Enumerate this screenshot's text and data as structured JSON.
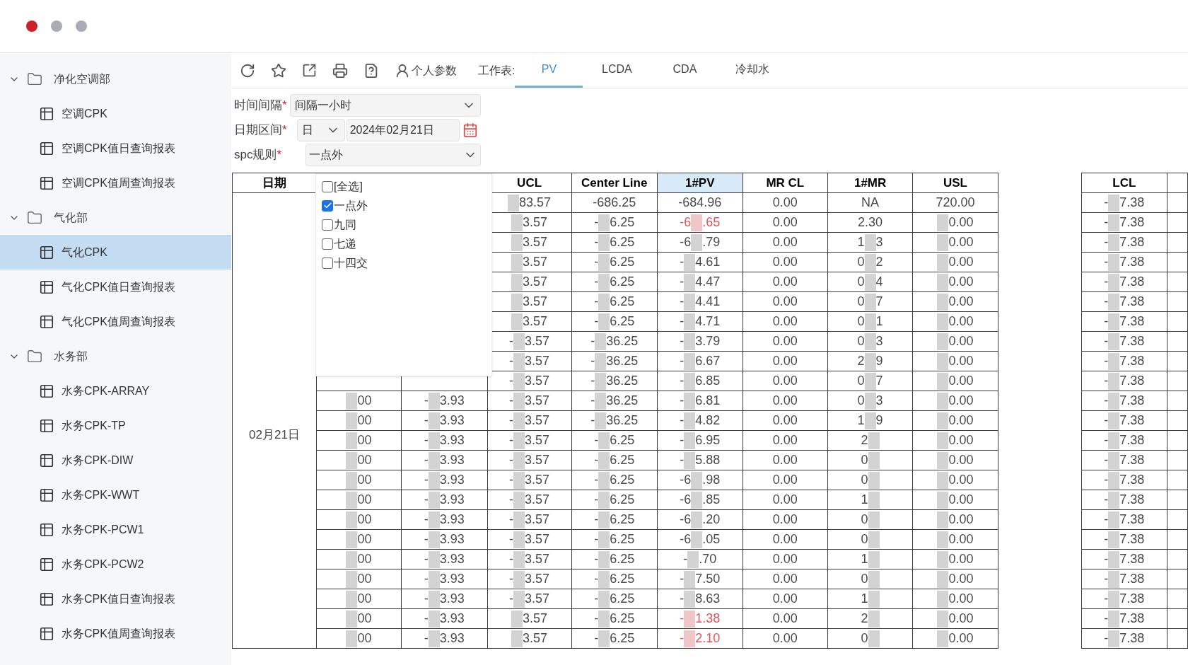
{
  "window_controls": [
    {
      "color": "#cf1f2b"
    },
    {
      "color": "#a9abb8"
    },
    {
      "color": "#a9abb8"
    }
  ],
  "sidebar": {
    "tree": [
      {
        "label": "净化空调部",
        "expanded": true,
        "children": [
          {
            "label": "空调CPK",
            "selected": false
          },
          {
            "label": "空调CPK值日查询报表",
            "selected": false
          },
          {
            "label": "空调CPK值周查询报表",
            "selected": false
          }
        ]
      },
      {
        "label": "气化部",
        "expanded": true,
        "children": [
          {
            "label": "气化CPK",
            "selected": true
          },
          {
            "label": "气化CPK值日查询报表",
            "selected": false
          },
          {
            "label": "气化CPK值周查询报表",
            "selected": false
          }
        ]
      },
      {
        "label": "水务部",
        "expanded": true,
        "children": [
          {
            "label": "水务CPK-ARRAY",
            "selected": false
          },
          {
            "label": "水务CPK-TP",
            "selected": false
          },
          {
            "label": "水务CPK-DIW",
            "selected": false
          },
          {
            "label": "水务CPK-WWT",
            "selected": false
          },
          {
            "label": "水务CPK-PCW1",
            "selected": false
          },
          {
            "label": "水务CPK-PCW2",
            "selected": false
          },
          {
            "label": "水务CPK值日查询报表",
            "selected": false
          },
          {
            "label": "水务CPK值周查询报表",
            "selected": false
          }
        ]
      }
    ]
  },
  "toolbar": {
    "personal_params": "个人参数",
    "sheet_label": "工作表:",
    "sheet_tabs": [
      {
        "label": "PV",
        "selected": true
      },
      {
        "label": "LCDA",
        "selected": false
      },
      {
        "label": "CDA",
        "selected": false
      },
      {
        "label": "冷却水",
        "selected": false
      }
    ]
  },
  "filters": {
    "interval": {
      "label": "时间间隔",
      "required_mark": "*",
      "value": "间隔一小时"
    },
    "date_range": {
      "label": "日期区间",
      "required_mark": "*",
      "unit": "日",
      "date": "2024年02月21日"
    },
    "spc_rule": {
      "label": "spc规则",
      "required_mark": "*",
      "value": "一点外",
      "open": true,
      "options": [
        {
          "label": "[全选]",
          "checked": false
        },
        {
          "label": "一点外",
          "checked": true
        },
        {
          "label": "九同",
          "checked": false
        },
        {
          "label": "七递",
          "checked": false
        },
        {
          "label": "十四交",
          "checked": false
        }
      ]
    }
  },
  "table": {
    "columns": [
      {
        "label": "日期",
        "highlighted": false
      },
      {
        "label": "UCL",
        "highlighted": false
      },
      {
        "label": "Center Line",
        "highlighted": false
      },
      {
        "label": "1#PV",
        "highlighted": true
      },
      {
        "label": "MR CL",
        "highlighted": false
      },
      {
        "label": "1#MR",
        "highlighted": false
      },
      {
        "label": "USL",
        "highlighted": false
      },
      {
        "label": "LCL",
        "highlighted": false
      }
    ],
    "date": "02月21日",
    "rows": [
      {
        "ucl": {
          "tail": "83.57"
        },
        "center": {
          "text": "-686.25"
        },
        "pv": {
          "text": "-684.96"
        },
        "pv_alert": false,
        "mr_cl": {
          "text": "0.00"
        },
        "mr": {
          "text": "NA"
        },
        "usl": {
          "text": "720.00"
        },
        "lcl": {
          "lead": "-",
          "tail": "7.38"
        }
      },
      {
        "ucl": {
          "tail": "3.57"
        },
        "center": {
          "lead": "-",
          "tail": "6.25"
        },
        "pv": {
          "lead": "-6",
          "tail": ".65"
        },
        "pv_alert": true,
        "mr_cl": {
          "text": "0.00"
        },
        "mr": {
          "text": "2.30"
        },
        "usl": {
          "tail": "0.00"
        },
        "lcl": {
          "lead": "-",
          "tail": "7.38"
        }
      },
      {
        "ucl": {
          "tail": "3.57"
        },
        "center": {
          "lead": "-",
          "tail": "6.25"
        },
        "pv": {
          "lead": "-6",
          "tail": ".79"
        },
        "pv_alert": false,
        "mr_cl": {
          "text": "0.00"
        },
        "mr": {
          "lead": "1",
          "tail": "3"
        },
        "usl": {
          "tail": "0.00"
        },
        "lcl": {
          "lead": "-",
          "tail": "7.38"
        }
      },
      {
        "ucl": {
          "tail": "3.57"
        },
        "center": {
          "lead": "-",
          "tail": "6.25"
        },
        "pv": {
          "lead": "-",
          "tail": "4.61"
        },
        "pv_alert": false,
        "mr_cl": {
          "text": "0.00"
        },
        "mr": {
          "lead": "0",
          "tail": "2"
        },
        "usl": {
          "tail": "0.00"
        },
        "lcl": {
          "lead": "-",
          "tail": "7.38"
        }
      },
      {
        "ucl": {
          "tail": "3.57"
        },
        "center": {
          "lead": "-",
          "tail": "6.25"
        },
        "pv": {
          "lead": "-",
          "tail": "4.47"
        },
        "pv_alert": false,
        "mr_cl": {
          "text": "0.00"
        },
        "mr": {
          "lead": "0",
          "tail": "4"
        },
        "usl": {
          "tail": "0.00"
        },
        "lcl": {
          "lead": "-",
          "tail": "7.38"
        }
      },
      {
        "ucl": {
          "tail": "3.57"
        },
        "center": {
          "lead": "-",
          "tail": "6.25"
        },
        "pv": {
          "lead": "-",
          "tail": "4.41"
        },
        "pv_alert": false,
        "mr_cl": {
          "text": "0.00"
        },
        "mr": {
          "lead": "0",
          "tail": "7"
        },
        "usl": {
          "tail": "0.00"
        },
        "lcl": {
          "lead": "-",
          "tail": "7.38"
        }
      },
      {
        "ucl": {
          "tail": "3.57"
        },
        "center": {
          "lead": "-",
          "tail": "6.25"
        },
        "pv": {
          "lead": "-",
          "tail": "4.71"
        },
        "pv_alert": false,
        "mr_cl": {
          "text": "0.00"
        },
        "mr": {
          "lead": "0",
          "tail": "1"
        },
        "usl": {
          "tail": "0.00"
        },
        "lcl": {
          "lead": "-",
          "tail": "7.38"
        }
      },
      {
        "ucl": {
          "lead": "-",
          "tail": "3.57"
        },
        "center": {
          "lead": "-",
          "tail": "36.25"
        },
        "pv": {
          "lead": "-",
          "tail": "3.79"
        },
        "pv_alert": false,
        "mr_cl": {
          "text": "0.00"
        },
        "mr": {
          "lead": "0",
          "tail": "3"
        },
        "usl": {
          "tail": "0.00"
        },
        "lcl": {
          "lead": "-",
          "tail": "7.38"
        }
      },
      {
        "ucl": {
          "lead": "-",
          "tail": "3.57"
        },
        "center": {
          "lead": "-",
          "tail": "36.25"
        },
        "pv": {
          "lead": "-",
          "tail": "6.67"
        },
        "pv_alert": false,
        "mr_cl": {
          "text": "0.00"
        },
        "mr": {
          "lead": "2",
          "tail": "9"
        },
        "usl": {
          "tail": "0.00"
        },
        "lcl": {
          "lead": "-",
          "tail": "7.38"
        }
      },
      {
        "ucl": {
          "lead": "-",
          "tail": "3.57"
        },
        "center": {
          "lead": "-",
          "tail": "36.25"
        },
        "pv": {
          "lead": "-",
          "tail": "6.85"
        },
        "pv_alert": false,
        "mr_cl": {
          "text": "0.00"
        },
        "mr": {
          "lead": "0",
          "tail": "7"
        },
        "usl": {
          "tail": "0.00"
        },
        "lcl": {
          "lead": "-",
          "tail": "7.38"
        }
      },
      {
        "time": {
          "tail": "00"
        },
        "value": {
          "lead": "-",
          "tail": "3.93"
        },
        "ucl": {
          "lead": "-",
          "tail": "3.57"
        },
        "center": {
          "lead": "-",
          "tail": "36.25"
        },
        "pv": {
          "lead": "-",
          "tail": "6.81"
        },
        "pv_alert": false,
        "mr_cl": {
          "text": "0.00"
        },
        "mr": {
          "lead": "0",
          "tail": "3"
        },
        "usl": {
          "tail": "0.00"
        },
        "lcl": {
          "lead": "-",
          "tail": "7.38"
        }
      },
      {
        "time": {
          "tail": "00"
        },
        "value": {
          "lead": "-",
          "tail": "3.93"
        },
        "ucl": {
          "lead": "-",
          "tail": "3.57"
        },
        "center": {
          "lead": "-",
          "tail": "36.25"
        },
        "pv": {
          "lead": "-",
          "tail": "4.82"
        },
        "pv_alert": false,
        "mr_cl": {
          "text": "0.00"
        },
        "mr": {
          "lead": "1",
          "tail": "9"
        },
        "usl": {
          "tail": "0.00"
        },
        "lcl": {
          "lead": "-",
          "tail": "7.38"
        }
      },
      {
        "time": {
          "tail": "00"
        },
        "value": {
          "lead": "-",
          "tail": "3.93"
        },
        "ucl": {
          "lead": "-",
          "tail": "3.57"
        },
        "center": {
          "lead": "-",
          "tail": "6.25"
        },
        "pv": {
          "lead": "-",
          "tail": "6.95"
        },
        "pv_alert": false,
        "mr_cl": {
          "text": "0.00"
        },
        "mr": {
          "lead": "2"
        },
        "usl": {
          "tail": "0.00"
        },
        "lcl": {
          "lead": "-",
          "tail": "7.38"
        }
      },
      {
        "time": {
          "tail": "00"
        },
        "value": {
          "lead": "-",
          "tail": "3.93"
        },
        "ucl": {
          "lead": "-",
          "tail": "3.57"
        },
        "center": {
          "lead": "-",
          "tail": "6.25"
        },
        "pv": {
          "lead": "-",
          "tail": "5.88"
        },
        "pv_alert": false,
        "mr_cl": {
          "text": "0.00"
        },
        "mr": {
          "lead": "0"
        },
        "usl": {
          "tail": "0.00"
        },
        "lcl": {
          "lead": "-",
          "tail": "7.38"
        }
      },
      {
        "time": {
          "tail": "00"
        },
        "value": {
          "lead": "-",
          "tail": "3.93"
        },
        "ucl": {
          "lead": "-",
          "tail": "3.57"
        },
        "center": {
          "lead": "-",
          "tail": "6.25"
        },
        "pv": {
          "lead": "-6",
          "tail": ".98"
        },
        "pv_alert": false,
        "mr_cl": {
          "text": "0.00"
        },
        "mr": {
          "lead": "0"
        },
        "usl": {
          "tail": "0.00"
        },
        "lcl": {
          "lead": "-",
          "tail": "7.38"
        }
      },
      {
        "time": {
          "tail": "00"
        },
        "value": {
          "lead": "-",
          "tail": "3.93"
        },
        "ucl": {
          "lead": "-",
          "tail": "3.57"
        },
        "center": {
          "lead": "-",
          "tail": "6.25"
        },
        "pv": {
          "lead": "-6",
          "tail": ".85"
        },
        "pv_alert": false,
        "mr_cl": {
          "text": "0.00"
        },
        "mr": {
          "lead": "1"
        },
        "usl": {
          "tail": "0.00"
        },
        "lcl": {
          "lead": "-",
          "tail": "7.38"
        }
      },
      {
        "time": {
          "tail": "00"
        },
        "value": {
          "lead": "-",
          "tail": "3.93"
        },
        "ucl": {
          "lead": "-",
          "tail": "3.57"
        },
        "center": {
          "lead": "-",
          "tail": "6.25"
        },
        "pv": {
          "lead": "-6",
          "tail": ".20"
        },
        "pv_alert": false,
        "mr_cl": {
          "text": "0.00"
        },
        "mr": {
          "lead": "0"
        },
        "usl": {
          "tail": "0.00"
        },
        "lcl": {
          "lead": "-",
          "tail": "7.38"
        }
      },
      {
        "time": {
          "tail": "00"
        },
        "value": {
          "lead": "-",
          "tail": "3.93"
        },
        "ucl": {
          "lead": "-",
          "tail": "3.57"
        },
        "center": {
          "lead": "-",
          "tail": "6.25"
        },
        "pv": {
          "lead": "-6",
          "tail": ".05"
        },
        "pv_alert": false,
        "mr_cl": {
          "text": "0.00"
        },
        "mr": {
          "lead": "0"
        },
        "usl": {
          "tail": "0.00"
        },
        "lcl": {
          "lead": "-",
          "tail": "7.38"
        }
      },
      {
        "time": {
          "tail": "00"
        },
        "value": {
          "lead": "-",
          "tail": "3.93"
        },
        "ucl": {
          "lead": "-",
          "tail": "3.57"
        },
        "center": {
          "lead": "-",
          "tail": "6.25"
        },
        "pv": {
          "lead": "-",
          "tail": ".70"
        },
        "pv_alert": false,
        "mr_cl": {
          "text": "0.00"
        },
        "mr": {
          "lead": "1"
        },
        "usl": {
          "tail": "0.00"
        },
        "lcl": {
          "lead": "-",
          "tail": "7.38"
        }
      },
      {
        "time": {
          "tail": "00"
        },
        "value": {
          "lead": "-",
          "tail": "3.93"
        },
        "ucl": {
          "lead": "-",
          "tail": "3.57"
        },
        "center": {
          "lead": "-",
          "tail": "6.25"
        },
        "pv": {
          "lead": "-",
          "tail": "7.50"
        },
        "pv_alert": false,
        "mr_cl": {
          "text": "0.00"
        },
        "mr": {
          "lead": "0"
        },
        "usl": {
          "tail": "0.00"
        },
        "lcl": {
          "lead": "-",
          "tail": "7.38"
        }
      },
      {
        "time": {
          "tail": "00"
        },
        "value": {
          "lead": "-",
          "tail": "3.93"
        },
        "ucl": {
          "lead": "-",
          "tail": "3.57"
        },
        "center": {
          "lead": "-",
          "tail": "6.25"
        },
        "pv": {
          "lead": "-",
          "tail": "8.63"
        },
        "pv_alert": false,
        "mr_cl": {
          "text": "0.00"
        },
        "mr": {
          "lead": "1"
        },
        "usl": {
          "tail": "0.00"
        },
        "lcl": {
          "lead": "-",
          "tail": "7.38"
        }
      },
      {
        "time": {
          "tail": "00"
        },
        "value": {
          "lead": "-",
          "tail": "3.93"
        },
        "ucl": {
          "tail": "3.57"
        },
        "center": {
          "lead": "-",
          "tail": "6.25"
        },
        "pv": {
          "lead": "-",
          "tail": "1.38"
        },
        "pv_alert": true,
        "mr_cl": {
          "text": "0.00"
        },
        "mr": {
          "lead": "2"
        },
        "usl": {
          "tail": "0.00"
        },
        "lcl": {
          "lead": "-",
          "tail": "7.38"
        }
      },
      {
        "time": {
          "tail": "00"
        },
        "value": {
          "lead": "-",
          "tail": "3.93"
        },
        "ucl": {
          "tail": "3.57"
        },
        "center": {
          "lead": "-",
          "tail": "6.25"
        },
        "pv": {
          "lead": "-",
          "tail": "2.10"
        },
        "pv_alert": true,
        "mr_cl": {
          "text": "0.00"
        },
        "mr": {
          "lead": "0"
        },
        "usl": {
          "tail": "0.00"
        },
        "lcl": {
          "lead": "-",
          "tail": "7.38"
        }
      }
    ]
  }
}
